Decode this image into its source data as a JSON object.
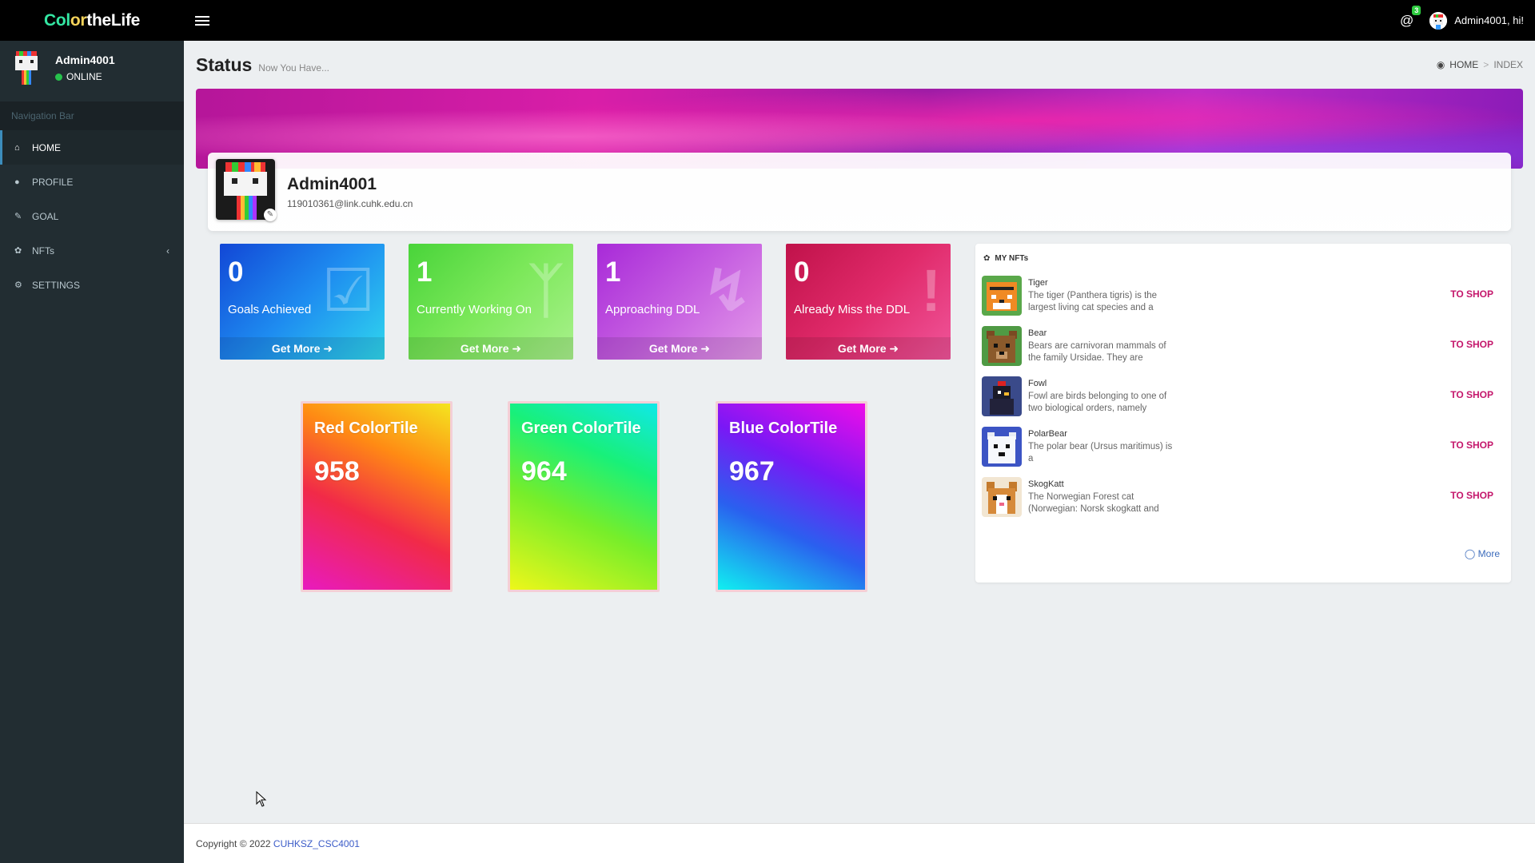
{
  "app": {
    "brand_parts": [
      "Col",
      "or",
      "the",
      "Li",
      "fe"
    ]
  },
  "topbar": {
    "notification_count": "3",
    "greeting": "Admin4001, hi!"
  },
  "sidebar": {
    "user_name": "Admin4001",
    "status": "ONLINE",
    "nav_header": "Navigation Bar",
    "items": [
      {
        "label": "HOME",
        "icon": "home-icon",
        "active": true
      },
      {
        "label": "PROFILE",
        "icon": "user-icon"
      },
      {
        "label": "GOAL",
        "icon": "edit-icon"
      },
      {
        "label": "NFTs",
        "icon": "paw-icon",
        "has_children": true
      },
      {
        "label": "SETTINGS",
        "icon": "gear-icon"
      }
    ]
  },
  "header": {
    "title": "Status",
    "subtitle": "Now You Have...",
    "breadcrumb": [
      "HOME",
      "INDEX"
    ]
  },
  "profile": {
    "name": "Admin4001",
    "email": "119010361@link.cuhk.edu.cn"
  },
  "stats": [
    {
      "value": "0",
      "label": "Goals Achieved",
      "more": "Get More",
      "icon": "check-square-icon",
      "color": "#1e8cf0"
    },
    {
      "value": "1",
      "label": "Currently Working On",
      "more": "Get More",
      "icon": "git-branch-icon",
      "color": "#7ce85a"
    },
    {
      "value": "1",
      "label": "Approaching DDL",
      "more": "Get More",
      "icon": "bolt-icon",
      "color": "#c65fe1"
    },
    {
      "value": "0",
      "label": "Already Miss the DDL",
      "more": "Get More",
      "icon": "exclamation-icon",
      "color": "#e02a6a"
    }
  ],
  "color_tiles": [
    {
      "name": "Red ColorTile",
      "value": "958"
    },
    {
      "name": "Green ColorTile",
      "value": "964"
    },
    {
      "name": "Blue ColorTile",
      "value": "967"
    }
  ],
  "nfts": {
    "title": "MY NFTs",
    "items": [
      {
        "name": "Tiger",
        "desc": "The tiger (Panthera tigris) is the largest living cat species and a",
        "action": "TO SHOP"
      },
      {
        "name": "Bear",
        "desc": "Bears are carnivoran mammals of the family Ursidae. They are",
        "action": "TO SHOP"
      },
      {
        "name": "Fowl",
        "desc": "Fowl are birds belonging to one of two biological orders, namely",
        "action": "TO SHOP"
      },
      {
        "name": "PolarBear",
        "desc": "The polar bear (Ursus maritimus) is a",
        "action": "TO SHOP"
      },
      {
        "name": "SkogKatt",
        "desc": "The Norwegian Forest cat (Norwegian: Norsk skogkatt and",
        "action": "TO SHOP"
      }
    ],
    "more": "More"
  },
  "footer": {
    "text": "Copyright © 2022",
    "link": "CUHKSZ_CSC4001"
  }
}
